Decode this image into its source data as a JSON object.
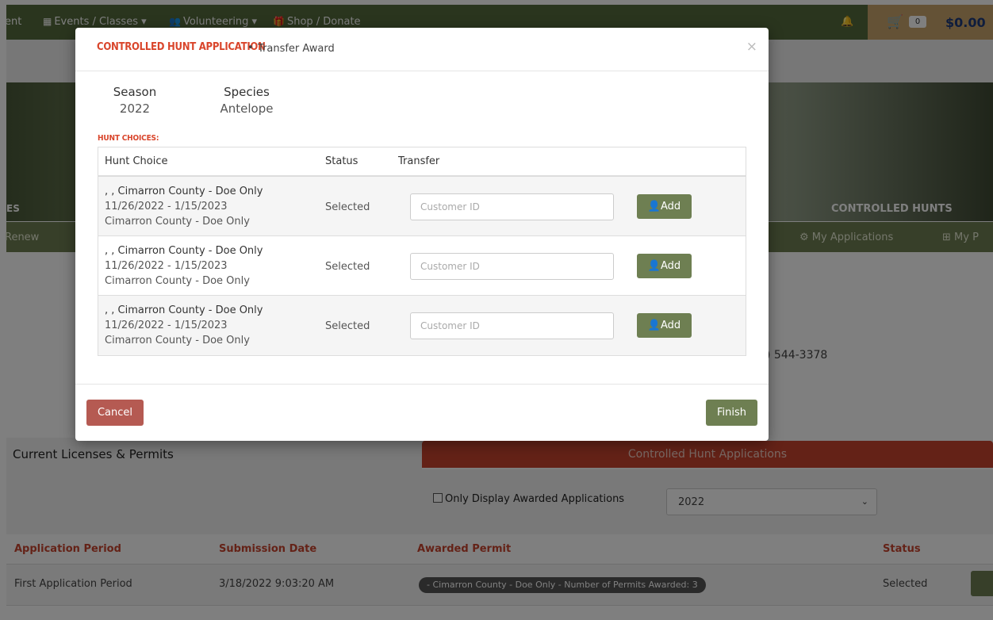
{
  "topnav": {
    "items": [
      {
        "label": "ent",
        "icon": ""
      },
      {
        "label": "Events / Classes ▾",
        "icon": "calendar-icon"
      },
      {
        "label": "Volunteering ▾",
        "icon": "users-icon"
      },
      {
        "label": "Shop / Donate",
        "icon": "gift-icon"
      }
    ],
    "cart_count": "0",
    "cart_total": "$0.00"
  },
  "banner": {
    "left_label": "ES",
    "right_label": "CONTROLLED HUNTS"
  },
  "subnav": {
    "left": "Renew",
    "my_applications": "My Applications",
    "my_p": "My P"
  },
  "contact": {
    "phone": ") 544-3378"
  },
  "tabs": {
    "licenses": "Current Licenses & Permits",
    "controlled": "Controlled Hunt Applications"
  },
  "filter": {
    "checkbox_label": "Only Display Awarded Applications",
    "year_selected": "2022"
  },
  "applications": {
    "headers": [
      "Application Period",
      "Submission Date",
      "Awarded Permit",
      "Status"
    ],
    "rows": [
      {
        "period": "First Application Period",
        "date": "3/18/2022 9:03:20 AM",
        "permit": "- Cimarron County - Doe Only - Number of Permits Awarded: 3",
        "status": "Selected"
      }
    ]
  },
  "modal": {
    "title": "CONTROLLED HUNT APPLICATION",
    "dot": "•",
    "subtitle": "Transfer Award",
    "close": "×",
    "season_label": "Season",
    "season_value": "2022",
    "species_label": "Species",
    "species_value": "Antelope",
    "hunt_choices_label": "HUNT CHOICES:",
    "table_headers": [
      "Hunt Choice",
      "Status",
      "Transfer"
    ],
    "rows": [
      {
        "line1": ", , Cimarron County - Doe Only",
        "line2": "11/26/2022 - 1/15/2023",
        "line3": "Cimarron County - Doe Only",
        "status": "Selected",
        "placeholder": "Customer ID",
        "add_label": "Add"
      },
      {
        "line1": ", , Cimarron County - Doe Only",
        "line2": "11/26/2022 - 1/15/2023",
        "line3": "Cimarron County - Doe Only",
        "status": "Selected",
        "placeholder": "Customer ID",
        "add_label": "Add"
      },
      {
        "line1": ", , Cimarron County - Doe Only",
        "line2": "11/26/2022 - 1/15/2023",
        "line3": "Cimarron County - Doe Only",
        "status": "Selected",
        "placeholder": "Customer ID",
        "add_label": "Add"
      }
    ],
    "cancel_label": "Cancel",
    "finish_label": "Finish"
  }
}
